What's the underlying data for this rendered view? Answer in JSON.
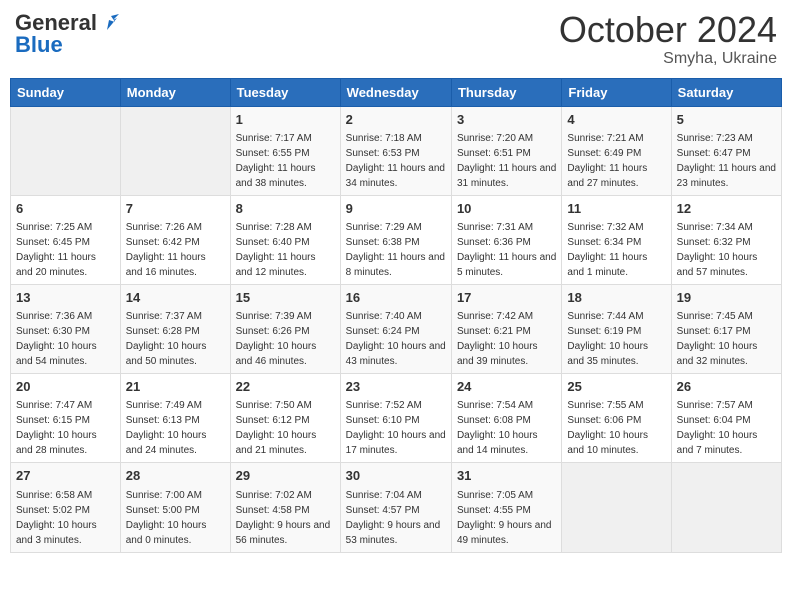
{
  "header": {
    "logo_line1": "General",
    "logo_line2": "Blue",
    "month": "October 2024",
    "location": "Smyha, Ukraine"
  },
  "days_of_week": [
    "Sunday",
    "Monday",
    "Tuesday",
    "Wednesday",
    "Thursday",
    "Friday",
    "Saturday"
  ],
  "weeks": [
    [
      {
        "day": "",
        "info": ""
      },
      {
        "day": "",
        "info": ""
      },
      {
        "day": "1",
        "info": "Sunrise: 7:17 AM\nSunset: 6:55 PM\nDaylight: 11 hours and 38 minutes."
      },
      {
        "day": "2",
        "info": "Sunrise: 7:18 AM\nSunset: 6:53 PM\nDaylight: 11 hours and 34 minutes."
      },
      {
        "day": "3",
        "info": "Sunrise: 7:20 AM\nSunset: 6:51 PM\nDaylight: 11 hours and 31 minutes."
      },
      {
        "day": "4",
        "info": "Sunrise: 7:21 AM\nSunset: 6:49 PM\nDaylight: 11 hours and 27 minutes."
      },
      {
        "day": "5",
        "info": "Sunrise: 7:23 AM\nSunset: 6:47 PM\nDaylight: 11 hours and 23 minutes."
      }
    ],
    [
      {
        "day": "6",
        "info": "Sunrise: 7:25 AM\nSunset: 6:45 PM\nDaylight: 11 hours and 20 minutes."
      },
      {
        "day": "7",
        "info": "Sunrise: 7:26 AM\nSunset: 6:42 PM\nDaylight: 11 hours and 16 minutes."
      },
      {
        "day": "8",
        "info": "Sunrise: 7:28 AM\nSunset: 6:40 PM\nDaylight: 11 hours and 12 minutes."
      },
      {
        "day": "9",
        "info": "Sunrise: 7:29 AM\nSunset: 6:38 PM\nDaylight: 11 hours and 8 minutes."
      },
      {
        "day": "10",
        "info": "Sunrise: 7:31 AM\nSunset: 6:36 PM\nDaylight: 11 hours and 5 minutes."
      },
      {
        "day": "11",
        "info": "Sunrise: 7:32 AM\nSunset: 6:34 PM\nDaylight: 11 hours and 1 minute."
      },
      {
        "day": "12",
        "info": "Sunrise: 7:34 AM\nSunset: 6:32 PM\nDaylight: 10 hours and 57 minutes."
      }
    ],
    [
      {
        "day": "13",
        "info": "Sunrise: 7:36 AM\nSunset: 6:30 PM\nDaylight: 10 hours and 54 minutes."
      },
      {
        "day": "14",
        "info": "Sunrise: 7:37 AM\nSunset: 6:28 PM\nDaylight: 10 hours and 50 minutes."
      },
      {
        "day": "15",
        "info": "Sunrise: 7:39 AM\nSunset: 6:26 PM\nDaylight: 10 hours and 46 minutes."
      },
      {
        "day": "16",
        "info": "Sunrise: 7:40 AM\nSunset: 6:24 PM\nDaylight: 10 hours and 43 minutes."
      },
      {
        "day": "17",
        "info": "Sunrise: 7:42 AM\nSunset: 6:21 PM\nDaylight: 10 hours and 39 minutes."
      },
      {
        "day": "18",
        "info": "Sunrise: 7:44 AM\nSunset: 6:19 PM\nDaylight: 10 hours and 35 minutes."
      },
      {
        "day": "19",
        "info": "Sunrise: 7:45 AM\nSunset: 6:17 PM\nDaylight: 10 hours and 32 minutes."
      }
    ],
    [
      {
        "day": "20",
        "info": "Sunrise: 7:47 AM\nSunset: 6:15 PM\nDaylight: 10 hours and 28 minutes."
      },
      {
        "day": "21",
        "info": "Sunrise: 7:49 AM\nSunset: 6:13 PM\nDaylight: 10 hours and 24 minutes."
      },
      {
        "day": "22",
        "info": "Sunrise: 7:50 AM\nSunset: 6:12 PM\nDaylight: 10 hours and 21 minutes."
      },
      {
        "day": "23",
        "info": "Sunrise: 7:52 AM\nSunset: 6:10 PM\nDaylight: 10 hours and 17 minutes."
      },
      {
        "day": "24",
        "info": "Sunrise: 7:54 AM\nSunset: 6:08 PM\nDaylight: 10 hours and 14 minutes."
      },
      {
        "day": "25",
        "info": "Sunrise: 7:55 AM\nSunset: 6:06 PM\nDaylight: 10 hours and 10 minutes."
      },
      {
        "day": "26",
        "info": "Sunrise: 7:57 AM\nSunset: 6:04 PM\nDaylight: 10 hours and 7 minutes."
      }
    ],
    [
      {
        "day": "27",
        "info": "Sunrise: 6:58 AM\nSunset: 5:02 PM\nDaylight: 10 hours and 3 minutes."
      },
      {
        "day": "28",
        "info": "Sunrise: 7:00 AM\nSunset: 5:00 PM\nDaylight: 10 hours and 0 minutes."
      },
      {
        "day": "29",
        "info": "Sunrise: 7:02 AM\nSunset: 4:58 PM\nDaylight: 9 hours and 56 minutes."
      },
      {
        "day": "30",
        "info": "Sunrise: 7:04 AM\nSunset: 4:57 PM\nDaylight: 9 hours and 53 minutes."
      },
      {
        "day": "31",
        "info": "Sunrise: 7:05 AM\nSunset: 4:55 PM\nDaylight: 9 hours and 49 minutes."
      },
      {
        "day": "",
        "info": ""
      },
      {
        "day": "",
        "info": ""
      }
    ]
  ]
}
